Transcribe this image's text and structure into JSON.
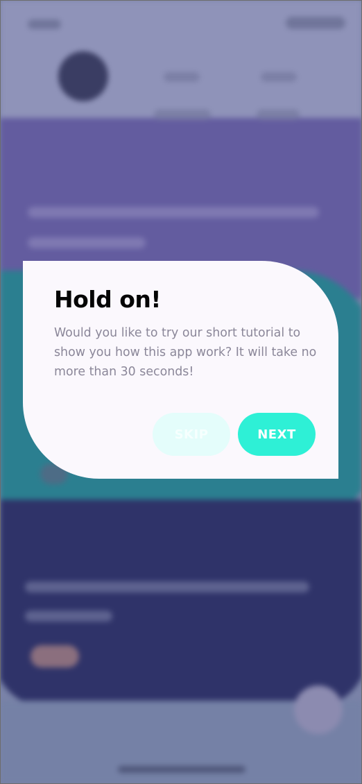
{
  "dialog": {
    "title": "Hold on!",
    "message": "Would you like to try our short tutorial to show you how this app work? It will take no more than 30 seconds!",
    "skip_label": "SKIP",
    "next_label": "NEXT"
  },
  "colors": {
    "accent": "#2ef0d6",
    "skip_bg": "#e4fdfb",
    "dialog_bg": "#fbf8fd",
    "title": "#050505",
    "body_text": "#8b8799",
    "backdrop_purple": "#635c9f",
    "backdrop_teal": "#2b7f90",
    "backdrop_navy": "#2f3369"
  }
}
